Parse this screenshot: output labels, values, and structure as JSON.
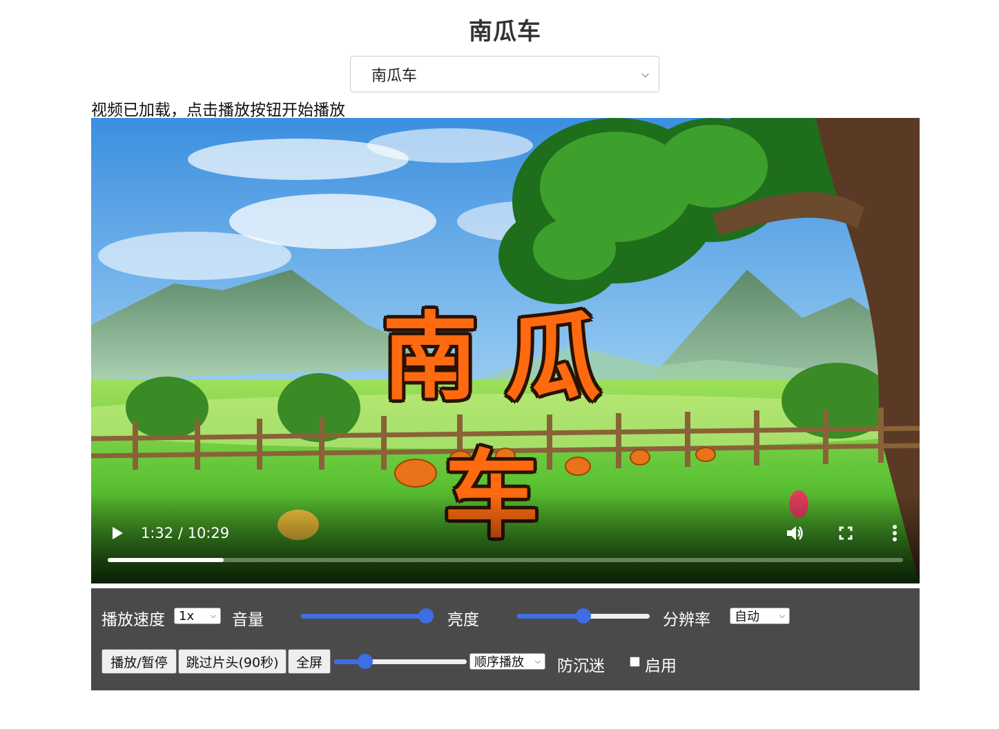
{
  "header": {
    "title": "南瓜车"
  },
  "video_select": {
    "selected": "南瓜车"
  },
  "status": {
    "text": "视频已加载，点击播放按钮开始播放"
  },
  "video": {
    "title_overlay": "南瓜车",
    "current_time": "1:32",
    "duration": "10:29",
    "time_display": "1:32 / 10:29",
    "progress_fraction": 0.1462,
    "icons": [
      "play-icon",
      "volume-icon",
      "fullscreen-icon",
      "more-options-icon"
    ]
  },
  "controls": {
    "speed_label": "播放速度",
    "speed_value": "1x",
    "volume_label": "音量",
    "volume_level": 1.0,
    "brightness_label": "亮度",
    "brightness_level": 0.5,
    "resolution_label": "分辨率",
    "resolution_value": "自动",
    "play_pause_label": "播放/暂停",
    "skip_intro_label": "跳过片头(90秒)",
    "fullscreen_label": "全屏",
    "seek_level": 0.2,
    "play_mode_value": "顺序播放",
    "anti_addiction_label": "防沉迷",
    "enable_label": "启用",
    "enable_checked": false
  },
  "colors": {
    "panel_bg": "#4a4a4a",
    "slider_accent": "#3e6de4",
    "title_orange": "#ff6a10"
  }
}
